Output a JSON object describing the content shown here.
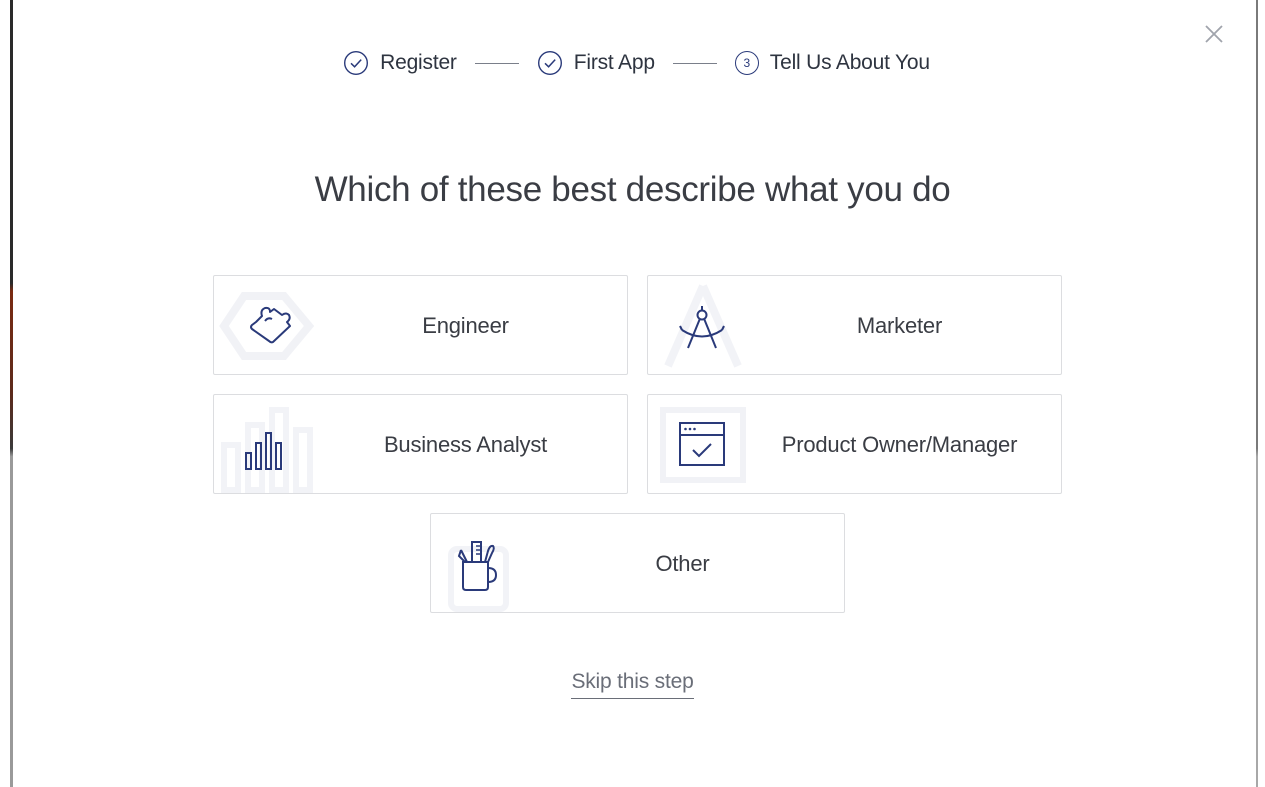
{
  "stepper": {
    "steps": [
      {
        "label": "Register",
        "state": "done"
      },
      {
        "label": "First App",
        "state": "done"
      },
      {
        "label": "Tell Us About You",
        "state": "current",
        "number": "3"
      }
    ]
  },
  "heading": "Which of these best describe what you do",
  "options": [
    {
      "label": "Engineer",
      "icon": "puzzle-piece-icon"
    },
    {
      "label": "Marketer",
      "icon": "compass-drawing-icon"
    },
    {
      "label": "Business Analyst",
      "icon": "bar-chart-icon"
    },
    {
      "label": "Product Owner/Manager",
      "icon": "browser-checkmark-icon"
    },
    {
      "label": "Other",
      "icon": "pencil-cup-icon"
    }
  ],
  "skip_label": "Skip this step",
  "colors": {
    "accent": "#2a3a7a",
    "text": "#3a3d44",
    "border": "#dcdde0",
    "muted": "#6a6e78"
  }
}
